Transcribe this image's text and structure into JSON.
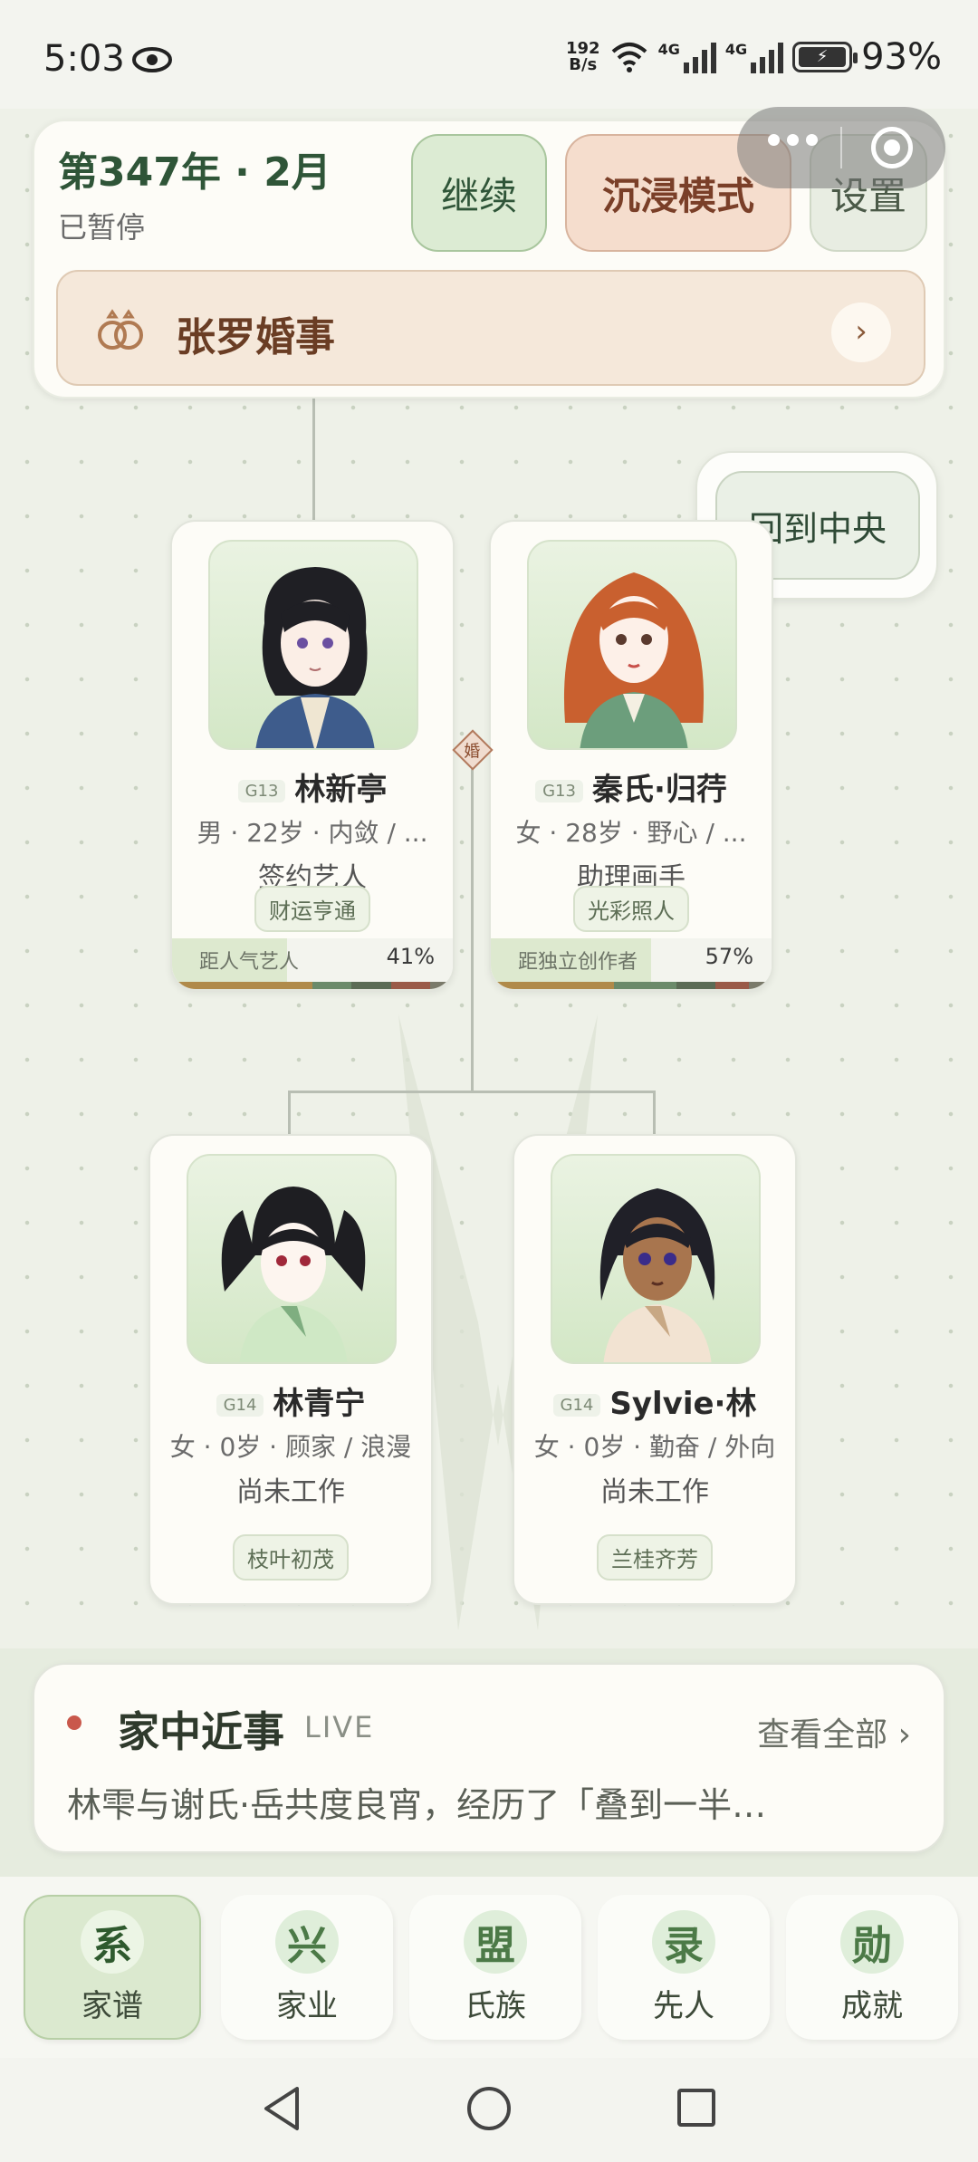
{
  "status": {
    "time": "5:03",
    "speed_value": "192",
    "speed_unit": "B/s",
    "net1": "4G",
    "net2": "4G",
    "battery": "93%"
  },
  "header": {
    "date": "第347年 · 2月",
    "state": "已暂停",
    "continue_label": "继续",
    "immersive_label": "沉浸模式",
    "settings_label": "设置",
    "event_title": "张罗婚事",
    "event_arrow": "›"
  },
  "center_button": "回到中央",
  "marriage_mark": "婚",
  "people": [
    {
      "gen": "G13",
      "name": "林新亭",
      "info": "男 · 22岁 · 内敛 / ...",
      "job": "签约艺人",
      "trait": "财运亨通",
      "progress_label": "距人气艺人",
      "progress_pct": "41%",
      "progress_value": 0.41
    },
    {
      "gen": "G13",
      "name": "秦氏·归荇",
      "info": "女 · 28岁 · 野心 / ...",
      "job": "助理画手",
      "trait": "光彩照人",
      "progress_label": "距独立创作者",
      "progress_pct": "57%",
      "progress_value": 0.57
    },
    {
      "gen": "G14",
      "name": "林青宁",
      "info": "女 · 0岁 · 顾家 / 浪漫",
      "job": "尚未工作",
      "trait": "枝叶初茂"
    },
    {
      "gen": "G14",
      "name": "Sylvie·林",
      "info": "女 · 0岁 · 勤奋 / 外向",
      "job": "尚未工作",
      "trait": "兰桂齐芳"
    }
  ],
  "news": {
    "title": "家中近事",
    "live": "LIVE",
    "view_all": "查看全部 ›",
    "text": "林雫与谢氏·岳共度良宵，经历了「叠到一半…"
  },
  "tabs": [
    {
      "icon": "系",
      "label": "家谱",
      "active": true
    },
    {
      "icon": "兴",
      "label": "家业",
      "active": false
    },
    {
      "icon": "盟",
      "label": "氏族",
      "active": false
    },
    {
      "icon": "录",
      "label": "先人",
      "active": false
    },
    {
      "icon": "勋",
      "label": "成就",
      "active": false
    }
  ],
  "colors": {
    "accent_green": "#2f5538",
    "immersive": "#f5ddcd",
    "news_dot": "#c9584b"
  }
}
